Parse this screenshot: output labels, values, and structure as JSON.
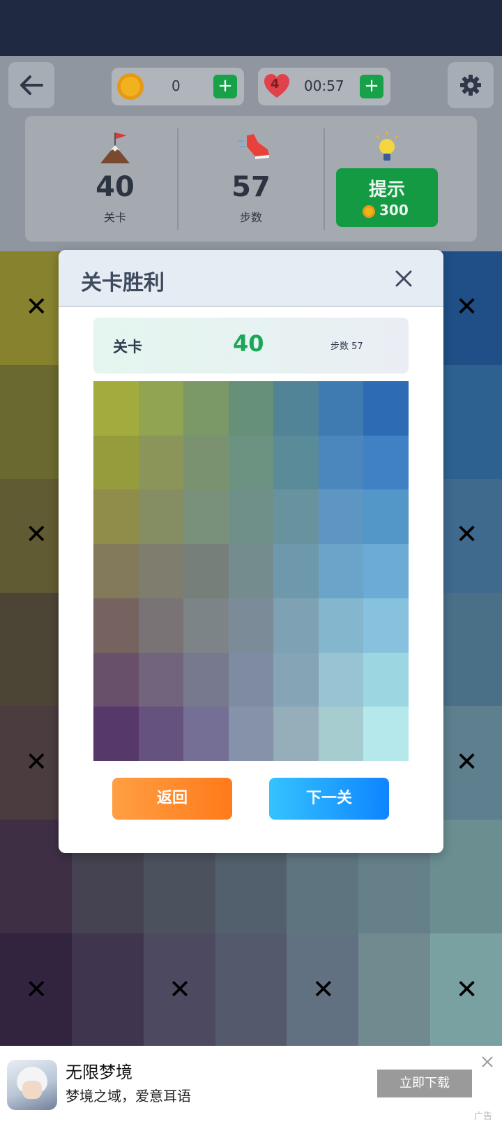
{
  "header": {
    "coins": "0",
    "lives": "4",
    "timer": "00:57",
    "plus_label": "+"
  },
  "stats": {
    "level_value": "40",
    "level_label": "关卡",
    "steps_value": "57",
    "steps_label": "步数",
    "hint_label": "提示",
    "hint_cost": "300"
  },
  "board": {
    "colors": [
      [
        "#86822e",
        "#85812e",
        "#7b7d3a",
        "#4e6e85",
        "#3f6d8d",
        "#2e6395",
        "#1f4f86"
      ],
      [
        "#6a6a30",
        "#65672f",
        "#5f6a46",
        "#4d6b79",
        "#486f8b",
        "#3a6f92",
        "#2d6290"
      ],
      [
        "#615b33",
        "#5f5b37",
        "#555e4c",
        "#536774",
        "#4f6d83",
        "#4a728f",
        "#3f6a8d"
      ],
      [
        "#4c4435",
        "#4b483b",
        "#4a4d4c",
        "#4c5a66",
        "#506a78",
        "#537889",
        "#4a7088"
      ],
      [
        "#4a3c3f",
        "#4a3f44",
        "#474850",
        "#4a5766",
        "#567080",
        "#62808e",
        "#5e7f8e"
      ],
      [
        "#3e2f45",
        "#454251",
        "#4c515e",
        "#525f6c",
        "#5e7580",
        "#66808a",
        "#6b8e91"
      ],
      [
        "#32243f",
        "#40354f",
        "#4d4960",
        "#54596c",
        "#627181",
        "#718a8f",
        "#7aa1a1"
      ]
    ],
    "x_cells": [
      [
        0,
        0
      ],
      [
        0,
        6
      ],
      [
        2,
        0
      ],
      [
        2,
        6
      ],
      [
        4,
        0
      ],
      [
        4,
        6
      ],
      [
        6,
        0
      ],
      [
        6,
        2
      ],
      [
        6,
        4
      ],
      [
        6,
        6
      ]
    ],
    "x_label": "✕"
  },
  "modal": {
    "title": "关卡胜利",
    "level_label": "关卡",
    "level_value": "40",
    "steps_text": "步数 57",
    "grid": [
      [
        "#a2ac3e",
        "#90a452",
        "#7a9966",
        "#679078",
        "#518496",
        "#3f7bb1",
        "#2d6bb4"
      ],
      [
        "#959c3c",
        "#8b9559",
        "#7b9270",
        "#6c9282",
        "#5a8b99",
        "#4b87bc",
        "#3f81c4"
      ],
      [
        "#908c49",
        "#858d62",
        "#79917a",
        "#6e9089",
        "#69929f",
        "#5e96c3",
        "#5396c8"
      ],
      [
        "#827a5a",
        "#7f7d6d",
        "#767f7a",
        "#758c8f",
        "#6e98ab",
        "#6ba4c9",
        "#6babd5"
      ],
      [
        "#76635f",
        "#797375",
        "#7c8488",
        "#7b8c98",
        "#7ea2b3",
        "#84b6ce",
        "#86c2de"
      ],
      [
        "#68506a",
        "#72647c",
        "#777a8e",
        "#7e8ba3",
        "#85a4b6",
        "#97c3d3",
        "#9cd6e1"
      ],
      [
        "#57386a",
        "#65527f",
        "#756f95",
        "#8592a9",
        "#96adba",
        "#a7ccd0",
        "#b5e8ea"
      ]
    ],
    "back_label": "返回",
    "next_label": "下一关"
  },
  "ad": {
    "title": "无限梦境",
    "subtitle": "梦境之域，爱意耳语",
    "cta": "立即下载",
    "ad_tag": "广告"
  }
}
